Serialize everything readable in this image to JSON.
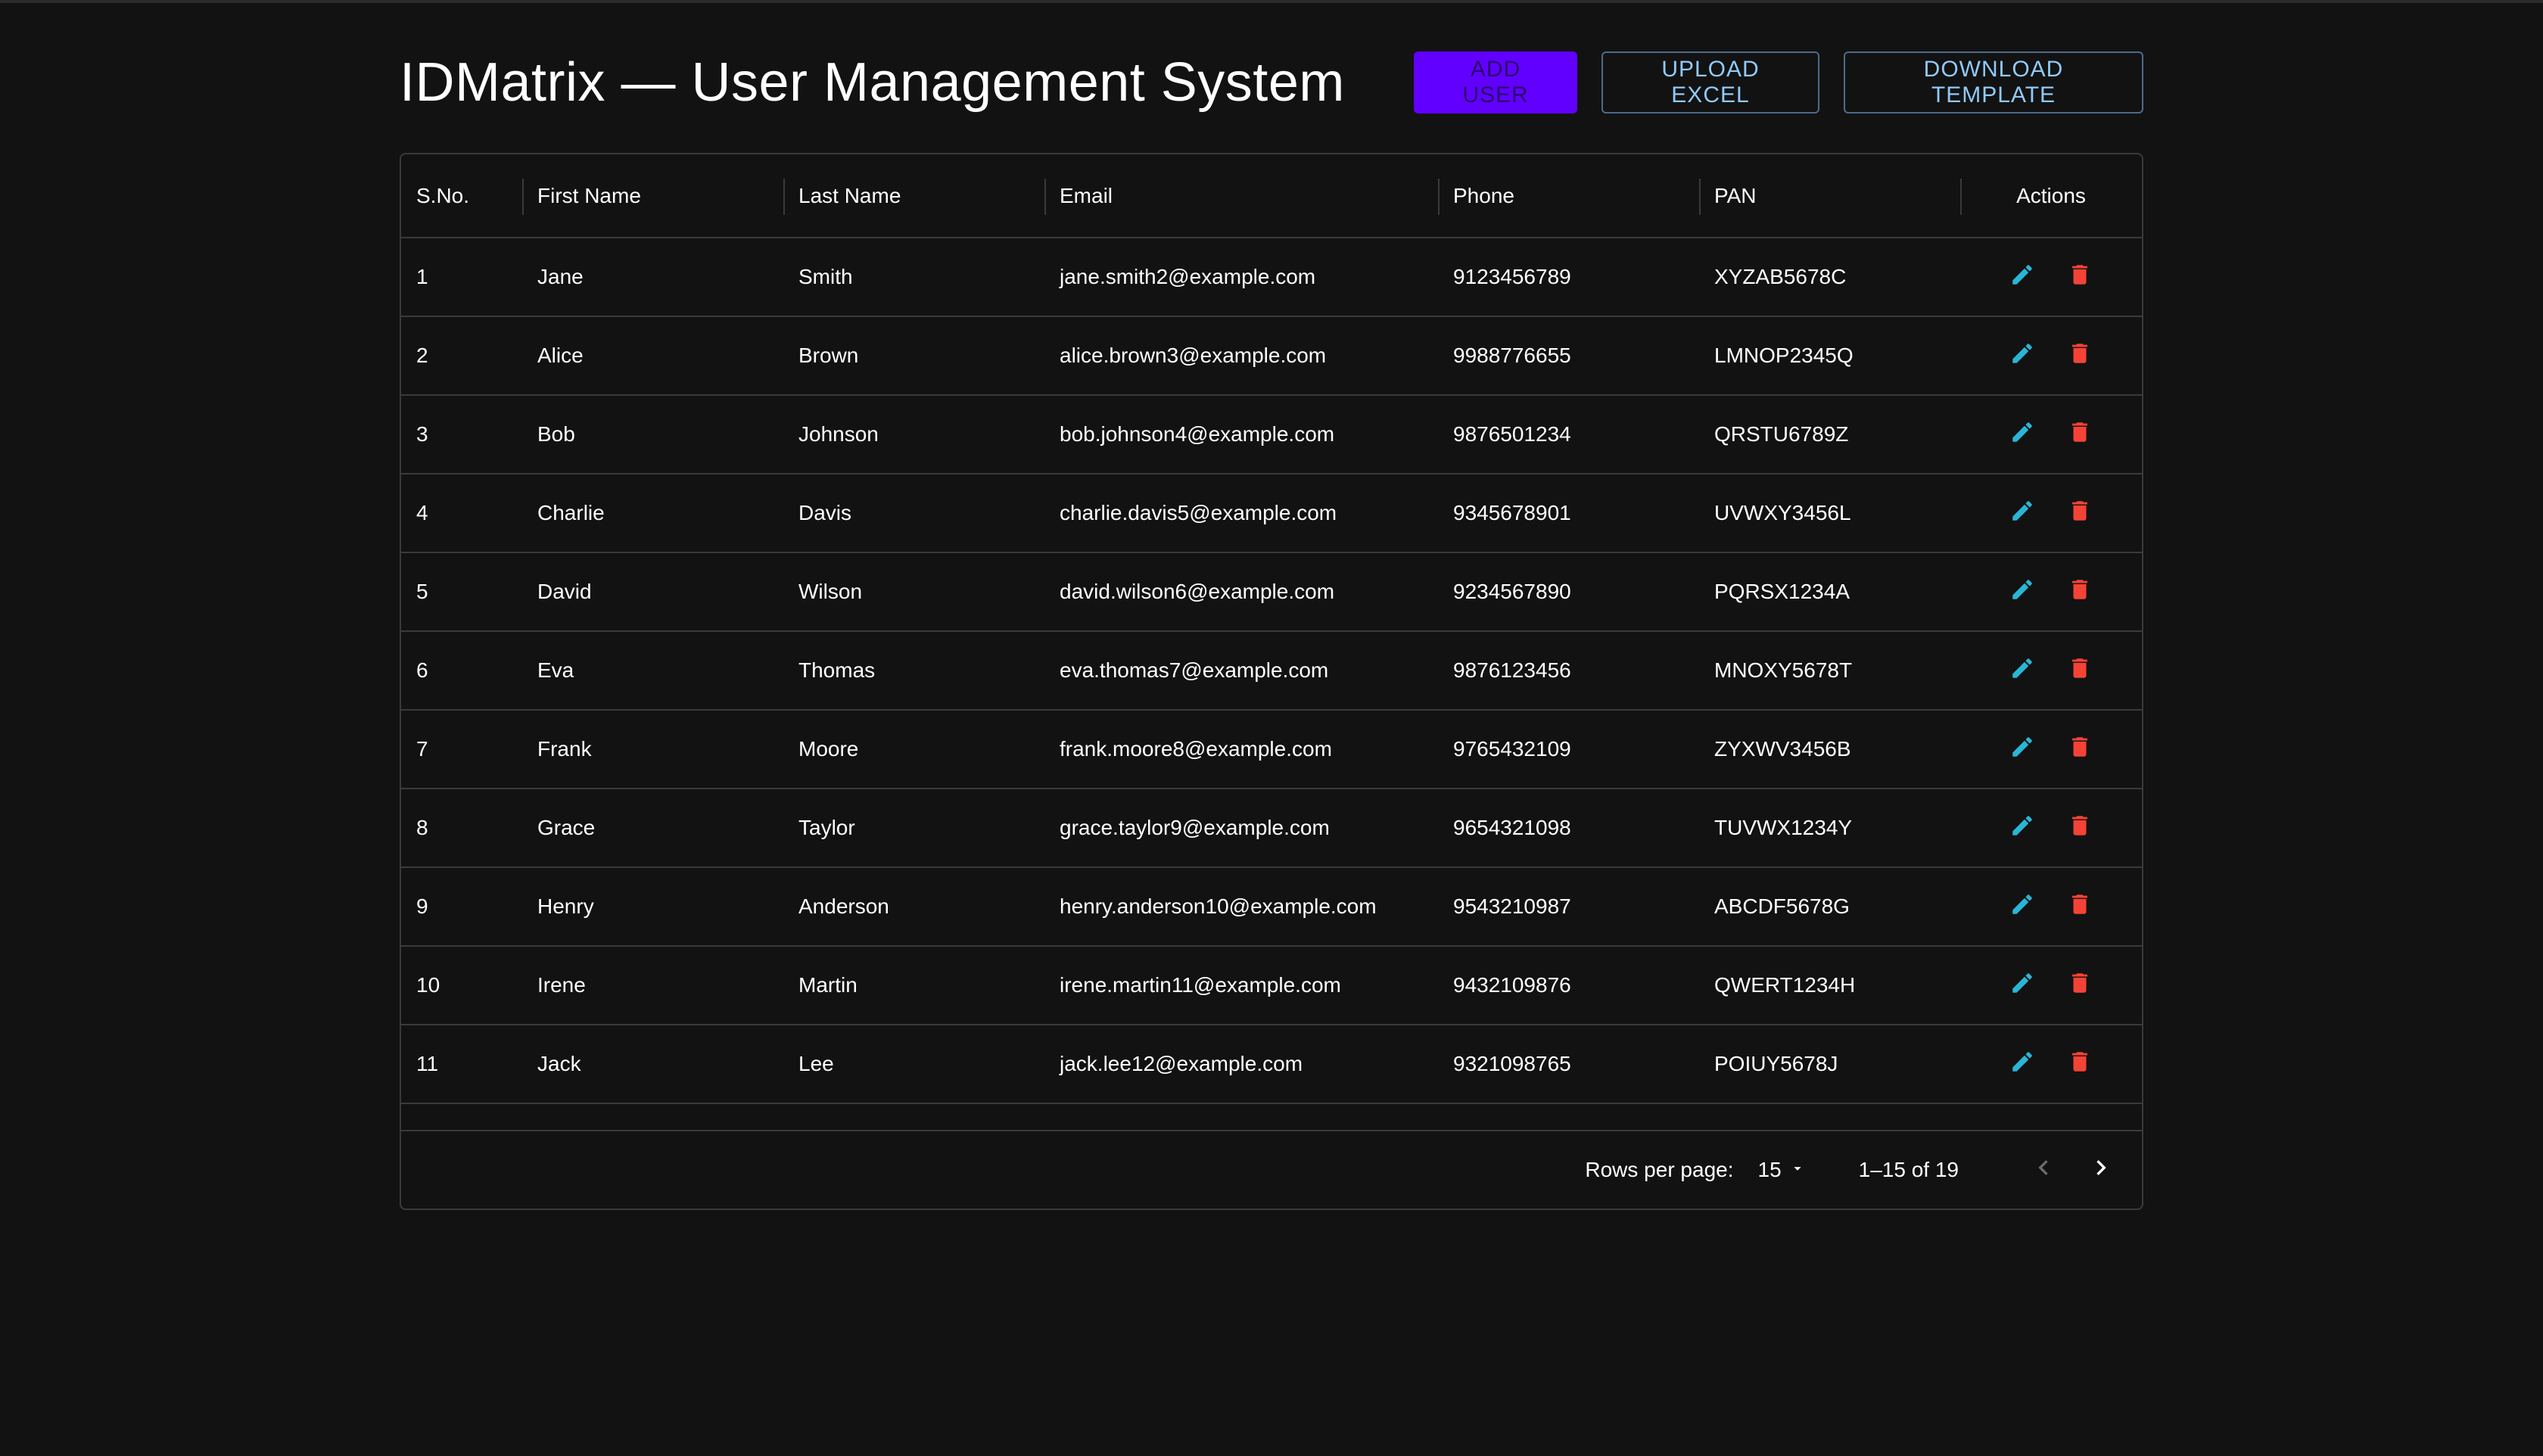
{
  "app": {
    "title": "IDMatrix — User Management System"
  },
  "toolbar": {
    "add_label": "ADD USER",
    "upload_label": "UPLOAD EXCEL",
    "download_label": "DOWNLOAD TEMPLATE"
  },
  "table": {
    "headers": {
      "sno": "S.No.",
      "first": "First Name",
      "last": "Last Name",
      "email": "Email",
      "phone": "Phone",
      "pan": "PAN",
      "actions": "Actions"
    },
    "rows": [
      {
        "sno": "1",
        "first": "Jane",
        "last": "Smith",
        "email": "jane.smith2@example.com",
        "phone": "9123456789",
        "pan": "XYZAB5678C"
      },
      {
        "sno": "2",
        "first": "Alice",
        "last": "Brown",
        "email": "alice.brown3@example.com",
        "phone": "9988776655",
        "pan": "LMNOP2345Q"
      },
      {
        "sno": "3",
        "first": "Bob",
        "last": "Johnson",
        "email": "bob.johnson4@example.com",
        "phone": "9876501234",
        "pan": "QRSTU6789Z"
      },
      {
        "sno": "4",
        "first": "Charlie",
        "last": "Davis",
        "email": "charlie.davis5@example.com",
        "phone": "9345678901",
        "pan": "UVWXY3456L"
      },
      {
        "sno": "5",
        "first": "David",
        "last": "Wilson",
        "email": "david.wilson6@example.com",
        "phone": "9234567890",
        "pan": "PQRSX1234A"
      },
      {
        "sno": "6",
        "first": "Eva",
        "last": "Thomas",
        "email": "eva.thomas7@example.com",
        "phone": "9876123456",
        "pan": "MNOXY5678T"
      },
      {
        "sno": "7",
        "first": "Frank",
        "last": "Moore",
        "email": "frank.moore8@example.com",
        "phone": "9765432109",
        "pan": "ZYXWV3456B"
      },
      {
        "sno": "8",
        "first": "Grace",
        "last": "Taylor",
        "email": "grace.taylor9@example.com",
        "phone": "9654321098",
        "pan": "TUVWX1234Y"
      },
      {
        "sno": "9",
        "first": "Henry",
        "last": "Anderson",
        "email": "henry.anderson10@example.com",
        "phone": "9543210987",
        "pan": "ABCDF5678G"
      },
      {
        "sno": "10",
        "first": "Irene",
        "last": "Martin",
        "email": "irene.martin11@example.com",
        "phone": "9432109876",
        "pan": "QWERT1234H"
      },
      {
        "sno": "11",
        "first": "Jack",
        "last": "Lee",
        "email": "jack.lee12@example.com",
        "phone": "9321098765",
        "pan": "POIUY5678J"
      }
    ],
    "row_actions": {
      "edit_icon": "pencil-icon",
      "delete_icon": "trash-icon"
    }
  },
  "pagination": {
    "rows_per_page_label": "Rows per page:",
    "rows_per_page_value": "15",
    "range_text": "1–15 of 19"
  },
  "colors": {
    "background": "#121212",
    "primary": "#6200ff",
    "outline_text": "#90caf9",
    "edit_icon": "#29b6d6",
    "delete_icon": "#f44336",
    "border": "#3a3a3a"
  }
}
